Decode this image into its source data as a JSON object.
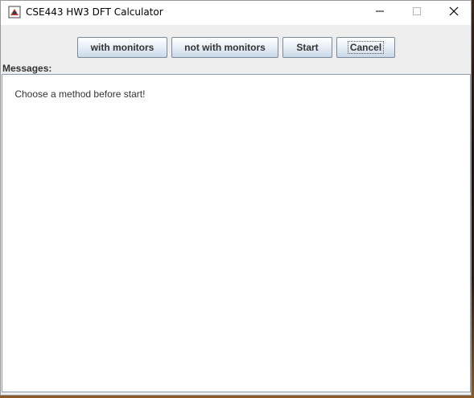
{
  "window": {
    "title": "CSE443 HW3 DFT Calculator"
  },
  "toolbar": {
    "with_monitors_label": "with monitors",
    "not_with_monitors_label": "not with monitors",
    "start_label": "Start",
    "cancel_label": "Cancel"
  },
  "messages": {
    "label": "Messages:",
    "text": "Choose a method before start!"
  },
  "icons": {
    "app": "java-cup-icon",
    "minimize": "minimize-icon",
    "maximize": "maximize-icon",
    "close": "close-icon"
  },
  "colors": {
    "window_bg": "#eeeeee",
    "button_border": "#7a8a99",
    "text": "#333333"
  }
}
